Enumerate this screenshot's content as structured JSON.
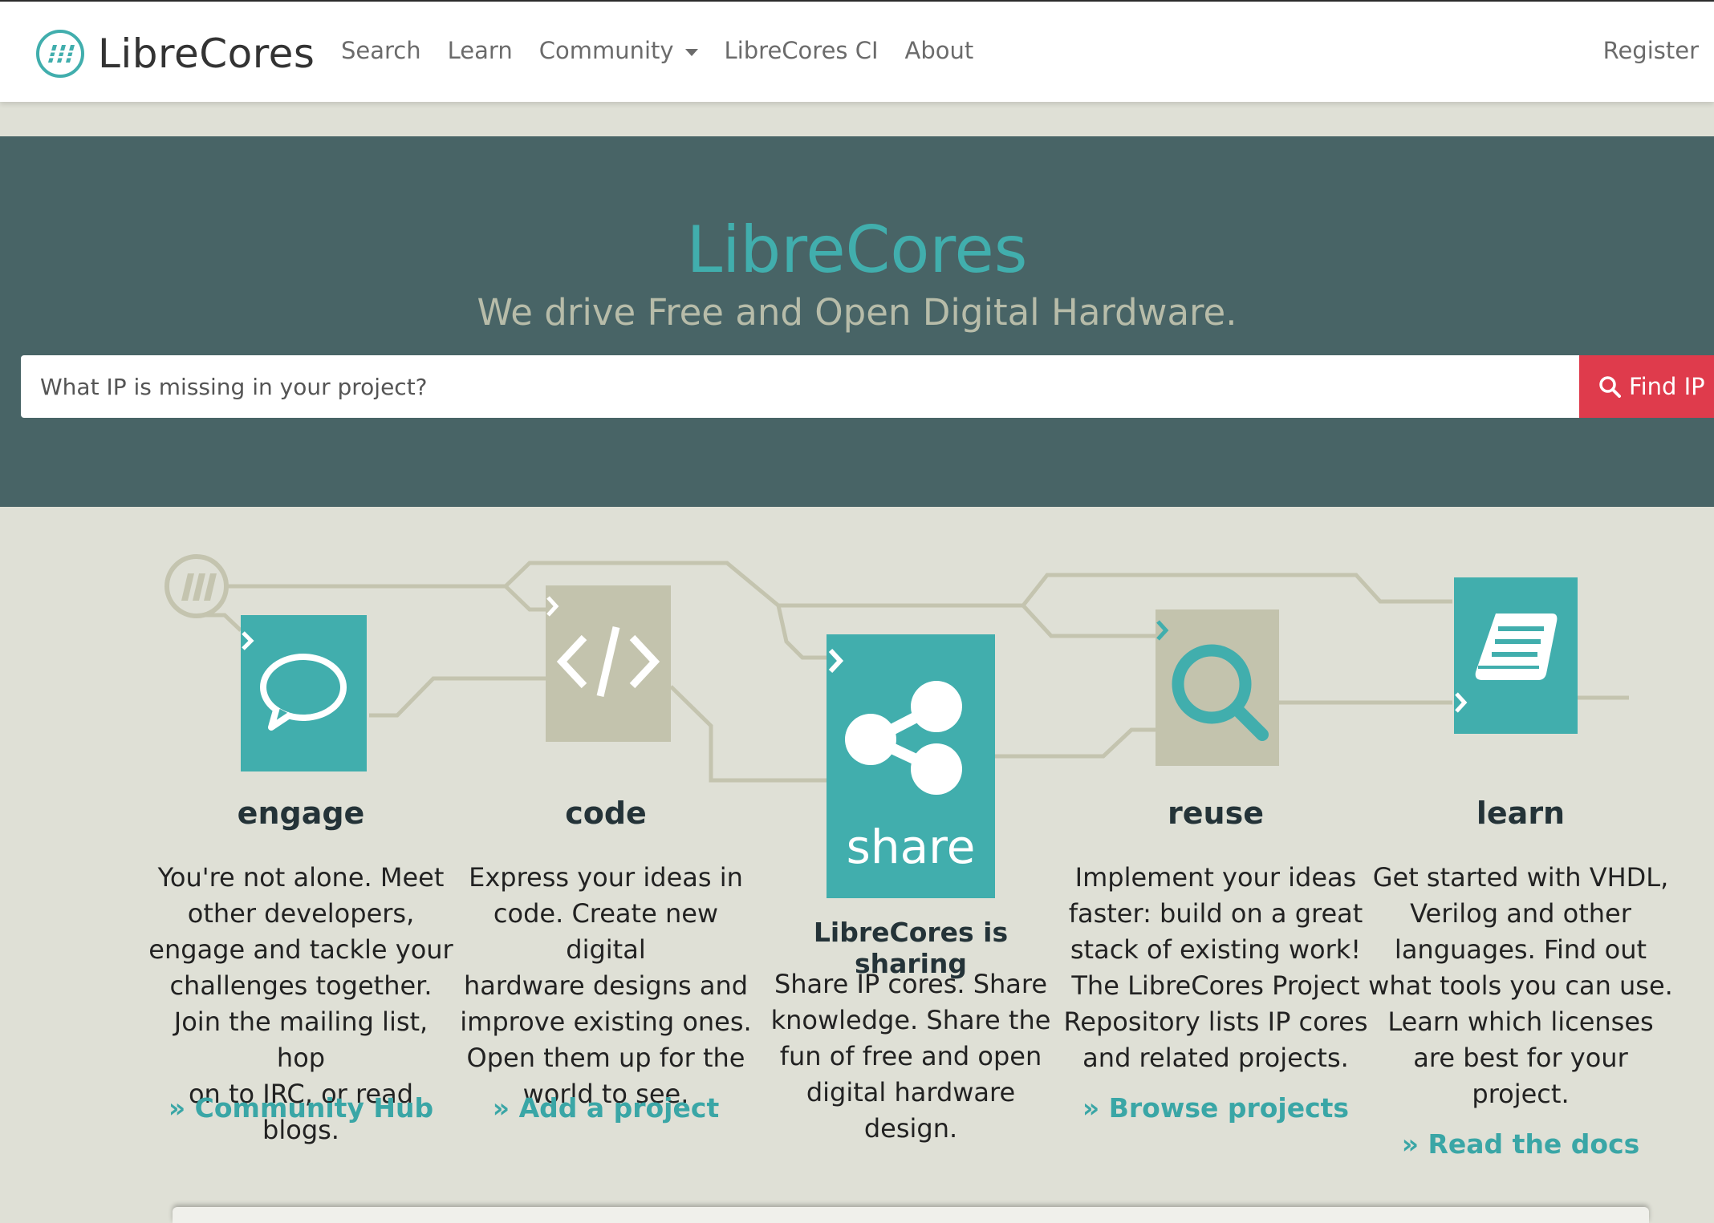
{
  "navbar": {
    "brand": "LibreCores",
    "links": [
      {
        "label": "Search"
      },
      {
        "label": "Learn"
      },
      {
        "label": "Community"
      },
      {
        "label": "LibreCores CI"
      },
      {
        "label": "About"
      }
    ],
    "register": "Register"
  },
  "hero": {
    "title": "LibreCores",
    "subtitle": "We drive Free and Open Digital Hardware.",
    "search_placeholder": "What IP is missing in your project?",
    "search_button": "Find IP F"
  },
  "colors": {
    "teal": "#41aead",
    "hero_bg": "#486466",
    "red": "#df3b4c",
    "beige_tile": "#c3c3ad",
    "page_bg": "#dfe0d6"
  },
  "features": [
    {
      "title": "engage",
      "icon": "speech-bubble-icon",
      "text": [
        "You're not alone. Meet",
        "other developers,",
        "engage and tackle your",
        "challenges together.",
        "Join the mailing list, hop",
        "on to IRC, or read blogs."
      ],
      "link": "» Community Hub"
    },
    {
      "title": "code",
      "icon": "code-icon",
      "text": [
        "Express your ideas in",
        "code. Create new digital",
        "hardware designs and",
        "improve existing ones.",
        "Open them up for the",
        "world to see."
      ],
      "link": "» Add a project"
    },
    {
      "title": "LibreCores is sharing",
      "icon": "share-icon",
      "tile_label": "share",
      "text": [
        "Share IP cores. Share",
        "knowledge. Share the",
        "fun of free and open",
        "digital hardware design."
      ],
      "link": ""
    },
    {
      "title": "reuse",
      "icon": "magnifier-icon",
      "text": [
        "Implement your ideas",
        "faster: build on a great",
        "stack of existing work!",
        "The LibreCores Project",
        "Repository lists IP cores",
        "and related projects."
      ],
      "link": "» Browse projects"
    },
    {
      "title": "learn",
      "icon": "book-icon",
      "text": [
        "Get started with VHDL,",
        "Verilog and other",
        "languages. Find out",
        "what tools you can use.",
        "Learn which licenses",
        "are best for your",
        "project."
      ],
      "link": "» Read the docs"
    }
  ]
}
